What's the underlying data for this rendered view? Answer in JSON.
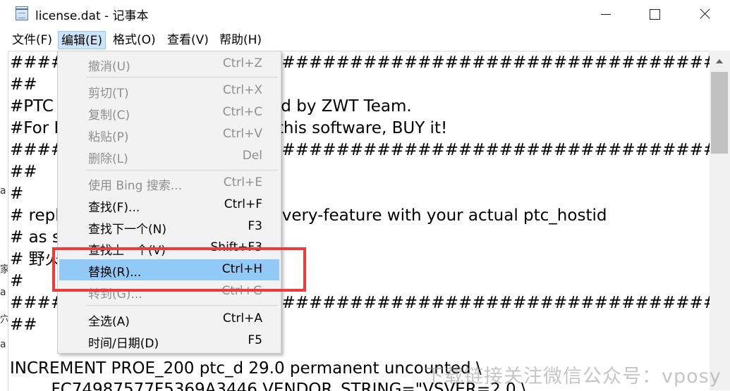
{
  "window": {
    "title": "license.dat - 记事本"
  },
  "menubar": {
    "items": [
      {
        "label": "文件(F)"
      },
      {
        "label": "编辑(E)"
      },
      {
        "label": "格式(O)"
      },
      {
        "label": "查看(V)"
      },
      {
        "label": "帮助(H)"
      }
    ]
  },
  "editor": {
    "lines": [
      "########################################################################",
      "##",
      "#PTC Creo License File, Generated by ZWT Team.",
      "#For Evaluation Only! If you like this software, BUY it!",
      "########################################################################",
      "##",
      "#",
      "# replace 00-00-00-00-00-00 in every-feature with your actual ptc_hostid",
      "# as shown below",
      "# 野火 www.xxx-site.ch",
      "#",
      "########################################################################",
      "##",
      "",
      "INCREMENT PROE_200 ptc_d 29.0 permanent uncounted \\",
      "        FC74987577F5369A3446 VENDOR_STRING=\"VSVER=2.0 \\"
    ]
  },
  "edit_menu": {
    "items": [
      {
        "label": "撤消(U)",
        "shortcut": "Ctrl+Z",
        "enabled": false
      },
      {
        "label": "剪切(T)",
        "shortcut": "Ctrl+X",
        "enabled": false
      },
      {
        "label": "复制(C)",
        "shortcut": "Ctrl+C",
        "enabled": false
      },
      {
        "label": "粘贴(P)",
        "shortcut": "Ctrl+V",
        "enabled": false
      },
      {
        "label": "删除(L)",
        "shortcut": "Del",
        "enabled": false
      },
      {
        "label": "使用 Bing 搜索...",
        "shortcut": "Ctrl+E",
        "enabled": false
      },
      {
        "label": "查找(F)...",
        "shortcut": "Ctrl+F",
        "enabled": true
      },
      {
        "label": "查找下一个(N)",
        "shortcut": "F3",
        "enabled": true
      },
      {
        "label": "查找上一个(V)",
        "shortcut": "Shift+F3",
        "enabled": true
      },
      {
        "label": "替换(R)...",
        "shortcut": "Ctrl+H",
        "enabled": true,
        "highlighted": true
      },
      {
        "label": "转到(G)...",
        "shortcut": "Ctrl+G",
        "enabled": false
      },
      {
        "label": "全选(A)",
        "shortcut": "Ctrl+A",
        "enabled": true
      },
      {
        "label": "时间/日期(D)",
        "shortcut": "F5",
        "enabled": true
      }
    ]
  },
  "background_sliver": [
    "a",
    "家",
    "a",
    "穴",
    "a"
  ],
  "watermark": "下载链接关注微信公众号：vposy",
  "colors": {
    "highlight": "#91c9f7",
    "annotation": "#f0393b",
    "menu_active": "#cce4f7"
  }
}
